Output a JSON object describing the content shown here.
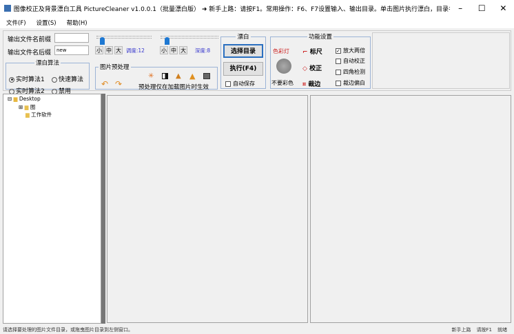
{
  "window": {
    "title": "图像校正及背景漂白工具 PictureCleaner v1.0.0.1（批量漂白版）  ➜ 新手上路：请按F1。常用操作：F6、F7设置输入、输出目录。单击图片执行漂白，目录名回车...",
    "minimize": "–",
    "maximize": "☐",
    "close": "✕"
  },
  "menu": [
    {
      "label": "文件(F)"
    },
    {
      "label": "设置(S)"
    },
    {
      "label": "帮助(H)"
    }
  ],
  "output": {
    "prefix_label": "输出文件名前缀",
    "prefix_value": "",
    "suffix_label": "输出文件名后缀",
    "suffix_value": "new"
  },
  "sliders": [
    {
      "sizes": [
        "小",
        "中",
        "大"
      ],
      "label": "调度:12",
      "value": 12
    },
    {
      "sizes": [
        "小",
        "中",
        "大"
      ],
      "label": "深度:8",
      "value": 8
    }
  ],
  "algo": {
    "title": "漂白算法",
    "options": [
      {
        "label": "实时算法1",
        "checked": true
      },
      {
        "label": "快速算法",
        "checked": false
      },
      {
        "label": "实时算法2",
        "checked": false
      },
      {
        "label": "禁用",
        "checked": false
      }
    ]
  },
  "preprocess": {
    "title": "图片预处理",
    "note": "预处理仅在加载图片时生效",
    "icons": [
      "undo-icon",
      "redo-icon",
      "brightness-icon",
      "contrast-icon",
      "levels-icon",
      "sharpen-icon",
      "color-adjust-icon"
    ]
  },
  "bleach": {
    "title": "漂白",
    "select_dir": "选择目录",
    "execute": "执行(F4)",
    "auto_save": "自动保存",
    "auto_save_checked": false
  },
  "features": {
    "title": "功能设置",
    "color_lamp": "色彩灯",
    "no_color": "不要彩色",
    "ruler": "标尺",
    "correct": "校正",
    "crop": "裁边",
    "checks": [
      {
        "label": "放大两倍",
        "checked": true
      },
      {
        "label": "自动校正",
        "checked": false
      },
      {
        "label": "四角检测",
        "checked": false
      },
      {
        "label": "裁边偏白",
        "checked": false
      }
    ]
  },
  "tree": {
    "root": "Desktop",
    "children": [
      {
        "label": "图",
        "expandable": true
      },
      {
        "label": "工作软件",
        "expandable": false
      }
    ]
  },
  "status": {
    "message": "请选择要处理的图片文件目录，或拖曳图片目录到左侧窗口。",
    "help1": "新手上路",
    "help2": "请按F1",
    "state": "就绪"
  },
  "colors": {
    "accent": "#1e78d2",
    "label_blue": "#3333cc",
    "red": "#cc2222"
  }
}
